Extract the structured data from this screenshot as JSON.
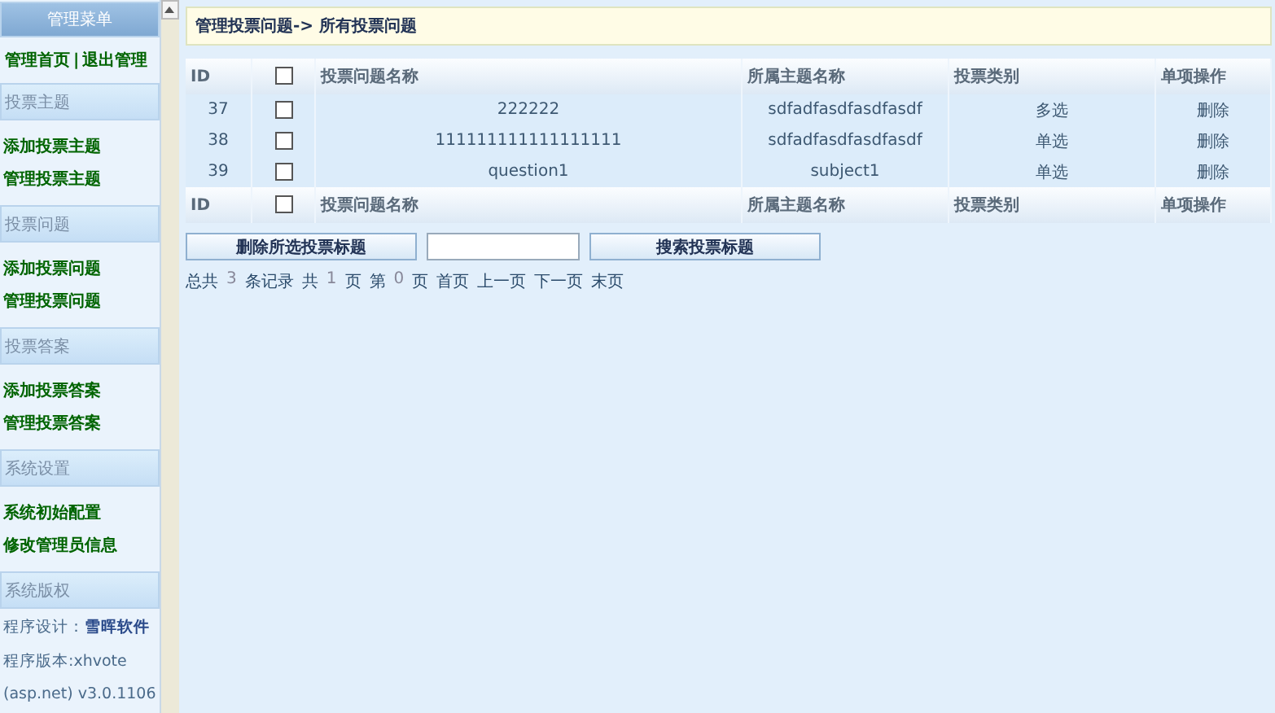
{
  "sidebar": {
    "title": "管理菜单",
    "top_links": [
      "管理首页",
      "退出管理"
    ],
    "top_separator": "|",
    "sections": [
      {
        "title": "投票主题",
        "items": [
          "添加投票主题",
          "管理投票主题"
        ]
      },
      {
        "title": "投票问题",
        "items": [
          "添加投票问题",
          "管理投票问题"
        ]
      },
      {
        "title": "投票答案",
        "items": [
          "添加投票答案",
          "管理投票答案"
        ]
      },
      {
        "title": "系统设置",
        "items": [
          "系统初始配置",
          "修改管理员信息"
        ]
      },
      {
        "title": "系统版权"
      }
    ],
    "credits": [
      "程序设计：**雪晖软件**",
      "程序版本:xhvote",
      "(asp.net) v3.0.1106"
    ]
  },
  "breadcrumb": "管理投票问题-> 所有投票问题",
  "table": {
    "columns": [
      "ID",
      "投票问题名称",
      "所属主题名称",
      "投票类别",
      "单项操作"
    ],
    "footer_columns": [
      "ID",
      "投票问题名称",
      "所属主题名称",
      "投票类别",
      "单项操作"
    ],
    "header_checked": false,
    "footer_checked": false,
    "rows": [
      {
        "id": "37",
        "checked": false,
        "name": "222222",
        "subject": "sdfadfasdfasdfasdf",
        "type": "多选",
        "action": "删除"
      },
      {
        "id": "38",
        "checked": false,
        "name": "111111111111111111",
        "subject": "sdfadfasdfasdfasdf",
        "type": "单选",
        "action": "删除"
      },
      {
        "id": "39",
        "checked": false,
        "name": "question1",
        "subject": "subject1",
        "type": "单选",
        "action": "删除"
      }
    ]
  },
  "actions": {
    "delete_button": "删除所选投票标题",
    "search_button": "搜索投票标题"
  },
  "pagination": [
    {
      "kind": "text",
      "text": "总共"
    },
    {
      "kind": "num",
      "text": "3"
    },
    {
      "kind": "text",
      "text": "条记录"
    },
    {
      "kind": "text",
      "text": "共"
    },
    {
      "kind": "num",
      "text": "1"
    },
    {
      "kind": "text",
      "text": "页"
    },
    {
      "kind": "text",
      "text": "第"
    },
    {
      "kind": "num",
      "text": "0"
    },
    {
      "kind": "text",
      "text": "页"
    },
    {
      "kind": "link",
      "text": "首页"
    },
    {
      "kind": "link",
      "text": "上一页"
    },
    {
      "kind": "link",
      "text": "下一页"
    },
    {
      "kind": "link",
      "text": "末页"
    }
  ]
}
